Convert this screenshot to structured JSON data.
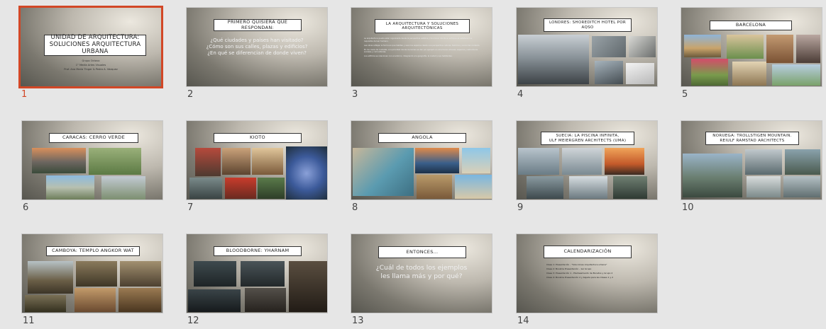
{
  "app": {
    "view": "slide-sorter"
  },
  "slides": [
    {
      "number": "1",
      "selected": true,
      "title": "UNIDAD DE ARQUITECTURA:\nSOLUCIONES ARQUITECTURA\nURBANA",
      "subtitle": "Grupo Octavo\n1° Media Artes Visuales\nProf. Ana María Tinger & Pedro A. Vázquez"
    },
    {
      "number": "2",
      "title": "PRIMERO QUISIERA QUE RESPONDAN:",
      "body": "¿Qué ciudades y países han visitado?\n¿Cómo son sus calles, plazas y edificios?\n¿En qué se diferencian de donde viven?"
    },
    {
      "number": "3",
      "title": "LA ARQUITECTURA Y SOLUCIONES\nARQUITECTÓNICAS",
      "bullets": [
        "La arquitectura puede estar organizada desde la perspectiva estética y funcional, donde su enfoque es satisfacer los requisitos del ser humano.",
        "Las obras reflejan la forma en que habitan y usan los espacios desde una perspectiva cultural, histórica y social del contexto.",
        "En los casos de ciudades, a la prioridad donde los temas se dan por ejemplo en soluciones urbanas, espacios y estructuras sociales y comunitarias.",
        "Los edificios se relacionan con el entorno, integrando a la geografía, la ciudad y sus habitantes."
      ]
    },
    {
      "number": "4",
      "title": "LONDRES: SHOREDITCH HOTEL POR\nAQSO"
    },
    {
      "number": "5",
      "title": "BARCELONA"
    },
    {
      "number": "6",
      "title": "CARACAS: CERRO VERDE"
    },
    {
      "number": "7",
      "title": "KIOTO"
    },
    {
      "number": "8",
      "title": "ANGOLA"
    },
    {
      "number": "9",
      "title": "SUECIA: LA PISCINA INFINITA,\nULF MEIERGREN ARCHITECTS (UMA)"
    },
    {
      "number": "10",
      "title": "NORUEGA: TROLLSTIGEN MOUNTAIN.\nREIULF RAMSTAD ARCHITECTS"
    },
    {
      "number": "11",
      "title": "CAMBOYA: TEMPLO ANGKOR WAT"
    },
    {
      "number": "12",
      "title": "BLOODBORNE: YHARNAM"
    },
    {
      "number": "13",
      "title": "ENTONCES…",
      "body": "¿Cuál de todos los ejemplos\nles llama más y por qué?"
    },
    {
      "number": "14",
      "title": "CALENDARIZACIÓN",
      "list": [
        "Clase 1: Presentación - \"Soluciones Arquitectura urbana\"",
        "Clase 2: Bocetos Presentación - 1er Grupo",
        "Clase 3: Presentación 1 - Planteamiento de Bocetos y Grupo 2",
        "Clase 4: Bocetos Presentación 2 y bajada para las Clases 1 y 2"
      ]
    }
  ],
  "colors": {
    "selection": "#d24726",
    "background": "#e6e6e6"
  }
}
